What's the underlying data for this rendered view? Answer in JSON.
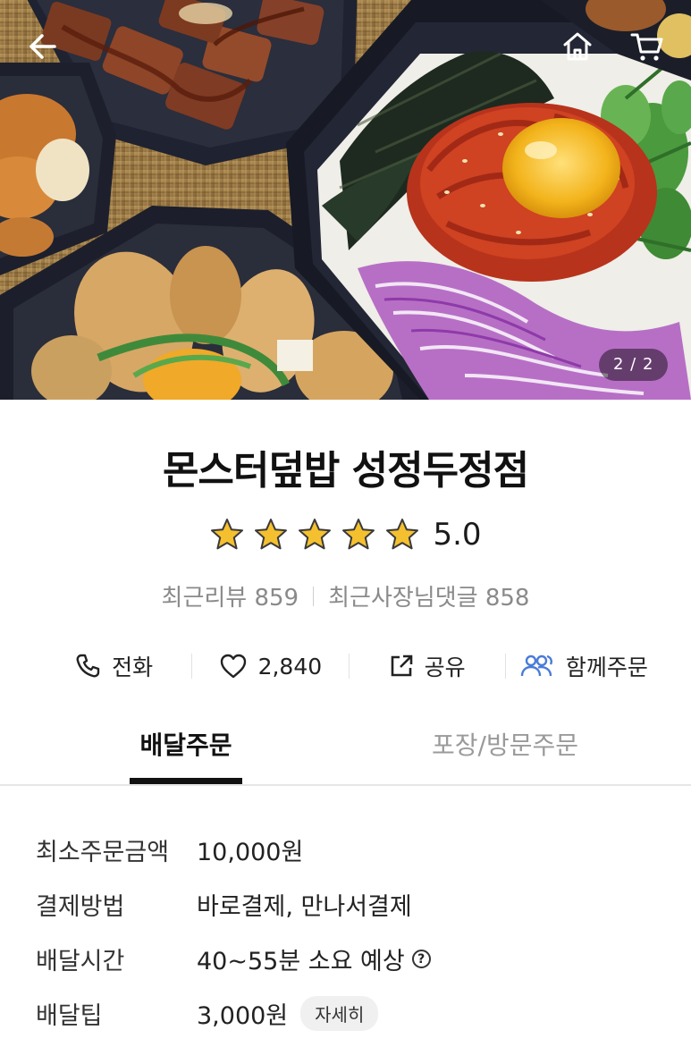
{
  "hero": {
    "counter": "2 / 2",
    "icons": {
      "back": "arrow-left-icon",
      "home": "home-icon",
      "cart": "cart-icon"
    }
  },
  "store": {
    "name": "몬스터덮밥 성정두정점",
    "rating": "5.0",
    "rating_value": 5,
    "rating_max": 5,
    "recent_reviews_label": "최근리뷰 859",
    "owner_replies_label": "최근사장님댓글 858"
  },
  "actions": [
    {
      "icon": "phone-icon",
      "label": "전화"
    },
    {
      "icon": "heart-icon",
      "label": "2,840"
    },
    {
      "icon": "share-icon",
      "label": "공유"
    },
    {
      "icon": "group-order-icon",
      "label": "함께주문"
    }
  ],
  "tabs": [
    {
      "label": "배달주문",
      "active": true
    },
    {
      "label": "포장/방문주문",
      "active": false
    }
  ],
  "info": {
    "min_order": {
      "label": "최소주문금액",
      "value": "10,000원"
    },
    "payment": {
      "label": "결제방법",
      "value": "바로결제, 만나서결제"
    },
    "delivery_time": {
      "label": "배달시간",
      "value": "40~55분 소요 예상",
      "help": "?"
    },
    "delivery_tip": {
      "label": "배달팁",
      "value": "3,000원",
      "detail_button": "자세히"
    }
  },
  "colors": {
    "star": "#f5c02f",
    "group_order_icon": "#4a7bd8",
    "tab_active": "#111111",
    "tab_inactive": "#9a9a9a"
  }
}
